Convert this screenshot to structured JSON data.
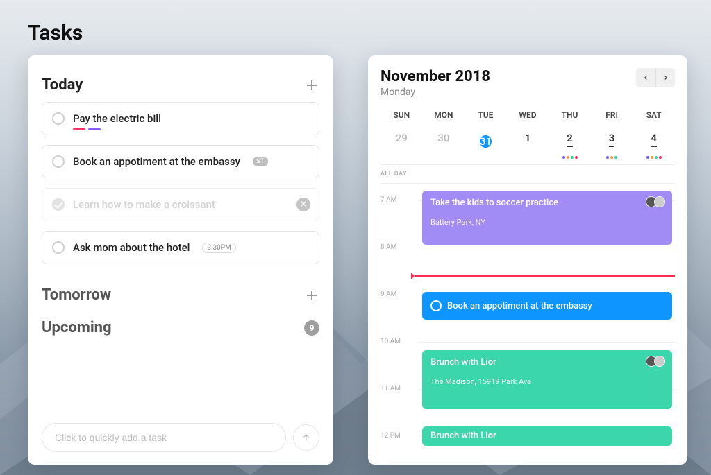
{
  "page": {
    "title": "Tasks"
  },
  "tasks": {
    "sections": {
      "today": {
        "title": "Today",
        "items": [
          {
            "title": "Pay the electric bill",
            "done": false,
            "tags": [
              "#ff3366",
              "#8a5cff"
            ],
            "badge": null,
            "time": null
          },
          {
            "title": "Book an appotiment at the embassy",
            "done": false,
            "tags": [],
            "badge": "ST",
            "time": null
          },
          {
            "title": "Learn how to make a croissant",
            "done": true,
            "tags": [],
            "badge": null,
            "time": null
          },
          {
            "title": "Ask mom about the hotel",
            "done": false,
            "tags": [],
            "badge": null,
            "time": "3:30PM"
          }
        ]
      },
      "tomorrow": {
        "title": "Tomorrow"
      },
      "upcoming": {
        "title": "Upcoming",
        "count": "9"
      }
    },
    "quick_add_placeholder": "Click to quickly add a task"
  },
  "calendar": {
    "month_title": "November 2018",
    "weekday": "Monday",
    "day_names": [
      "SUN",
      "MON",
      "TUE",
      "WED",
      "THU",
      "FRI",
      "SAT"
    ],
    "dates": [
      {
        "num": "29",
        "faded": true
      },
      {
        "num": "30",
        "faded": true
      },
      {
        "num": "31",
        "selected": true
      },
      {
        "num": "1"
      },
      {
        "num": "2",
        "underlined": true,
        "dots": [
          "#7c5cff",
          "#ff9d2e",
          "#3ad29f",
          "#ff3366"
        ]
      },
      {
        "num": "3",
        "underlined": true,
        "dots": [
          "#7c5cff",
          "#ff9d2e",
          "#3ad29f"
        ]
      },
      {
        "num": "4",
        "underlined": true,
        "dots": [
          "#7c5cff",
          "#ff9d2e",
          "#3ad29f",
          "#ff3366"
        ]
      }
    ],
    "allday_label": "ALL DAY",
    "time_labels": [
      "7 AM",
      "8 AM",
      "9 AM",
      "10 AM",
      "11 AM",
      "12 PM"
    ],
    "events": [
      {
        "title": "Take the kids to soccer practice",
        "sub": "Battery Park, NY",
        "color": "#a18cf5",
        "avatars": 2
      },
      {
        "title": "Book an appotiment at the embassy",
        "sub": null,
        "color": "#0e95ff",
        "show_circle": true
      },
      {
        "title": "Brunch with Lior",
        "sub": "The Madison, 15919 Park Ave",
        "color": "#3cd6ad",
        "avatars": 2
      },
      {
        "title": "Brunch with Lior",
        "sub": null,
        "color": "#3cd6ad"
      }
    ]
  }
}
